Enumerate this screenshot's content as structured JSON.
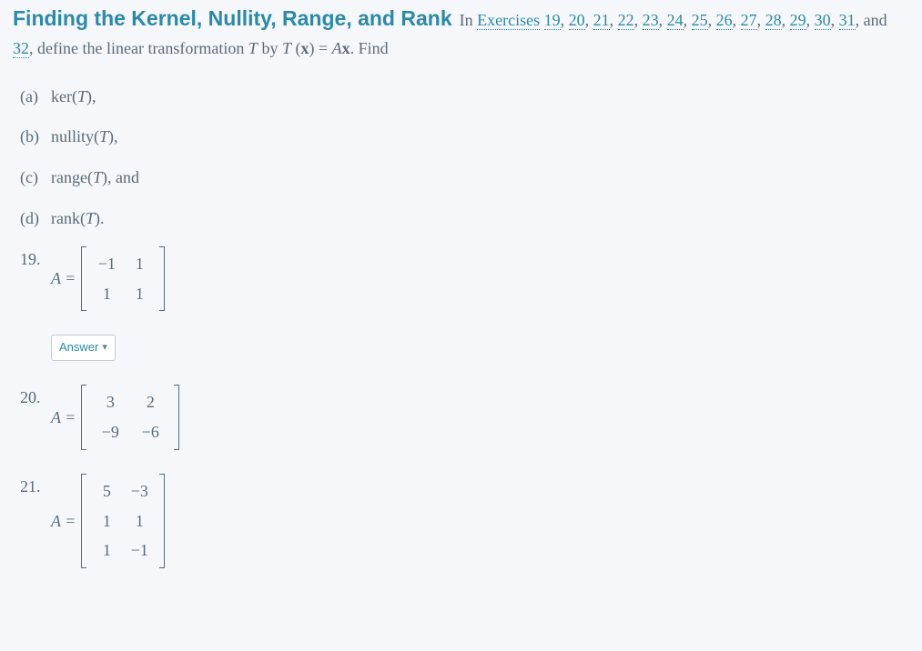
{
  "heading": {
    "title": "Finding the Kernel, Nullity, Range, and Rank",
    "prefix": "In ",
    "exercises_word": "Exercises",
    "ex_links": [
      "19",
      "20",
      "21",
      "22",
      "23",
      "24",
      "25",
      "26",
      "27",
      "28",
      "29",
      "30",
      "31"
    ],
    "ex_last": "32",
    "after_links": ", define the linear transformation ",
    "T": "T",
    "by": " by ",
    "Tx": "T (x) = Ax",
    "period": ". Find"
  },
  "parts": {
    "a": {
      "label": "(a)",
      "op": "ker",
      "arg": "T",
      "tail": ","
    },
    "b": {
      "label": "(b)",
      "op": "nullity",
      "arg": "T",
      "tail": ","
    },
    "c": {
      "label": "(c)",
      "op": "range",
      "arg": "T",
      "tail": ", and"
    },
    "d": {
      "label": "(d)",
      "op": "rank",
      "arg": "T",
      "tail": "."
    }
  },
  "problems": {
    "p19": {
      "num": "19.",
      "lhs": "A =",
      "rows": [
        [
          "−1",
          "1"
        ],
        [
          "1",
          "1"
        ]
      ]
    },
    "p20": {
      "num": "20.",
      "lhs": "A =",
      "rows": [
        [
          "3",
          "2"
        ],
        [
          "−9",
          "−6"
        ]
      ]
    },
    "p21": {
      "num": "21.",
      "lhs": "A =",
      "rows": [
        [
          "5",
          "−3"
        ],
        [
          "1",
          "1"
        ],
        [
          "1",
          "−1"
        ]
      ]
    }
  },
  "answer_button": {
    "label": "Answer"
  }
}
